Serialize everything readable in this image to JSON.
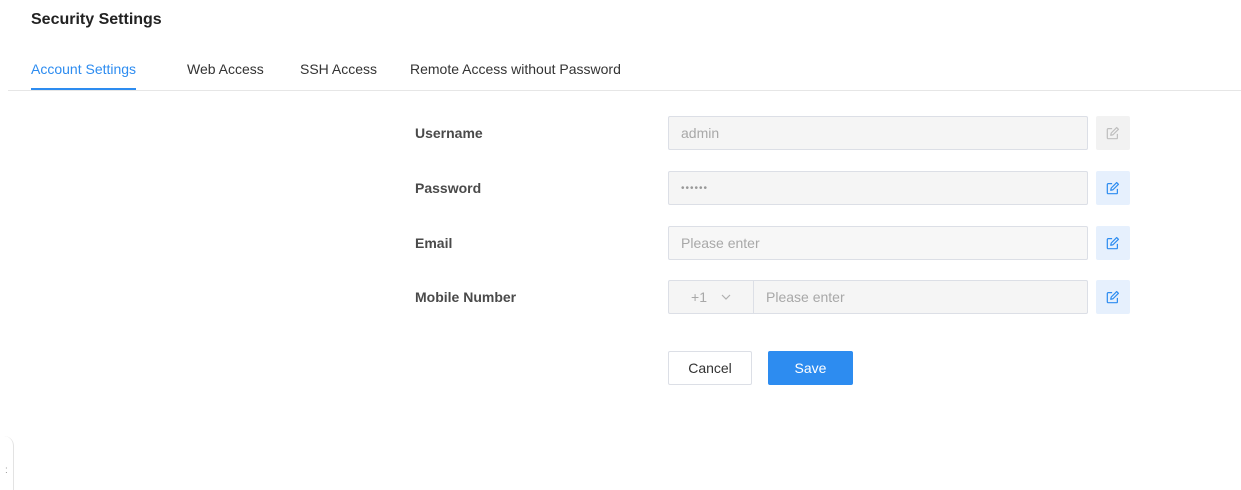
{
  "page": {
    "title": "Security Settings"
  },
  "tabs": [
    {
      "label": "Account Settings",
      "active": true
    },
    {
      "label": "Web Access",
      "active": false
    },
    {
      "label": "SSH Access",
      "active": false
    },
    {
      "label": "Remote Access without Password",
      "active": false
    }
  ],
  "form": {
    "username": {
      "label": "Username",
      "value": "admin",
      "edit_enabled": false
    },
    "password": {
      "label": "Password",
      "value": "••••••",
      "edit_enabled": true
    },
    "email": {
      "label": "Email",
      "placeholder": "Please enter",
      "edit_enabled": true
    },
    "mobile": {
      "label": "Mobile Number",
      "country_code": "+1",
      "placeholder": "Please enter",
      "edit_enabled": true
    }
  },
  "actions": {
    "cancel_label": "Cancel",
    "save_label": "Save"
  },
  "side_handle": {
    "glyph": ":"
  },
  "colors": {
    "accent": "#2d8cf0",
    "edit_button_bg": "#e6f0fd",
    "disabled_bg": "#f5f5f5"
  },
  "icons": {
    "edit": "edit-icon",
    "dropdown": "chevron-down-icon"
  }
}
